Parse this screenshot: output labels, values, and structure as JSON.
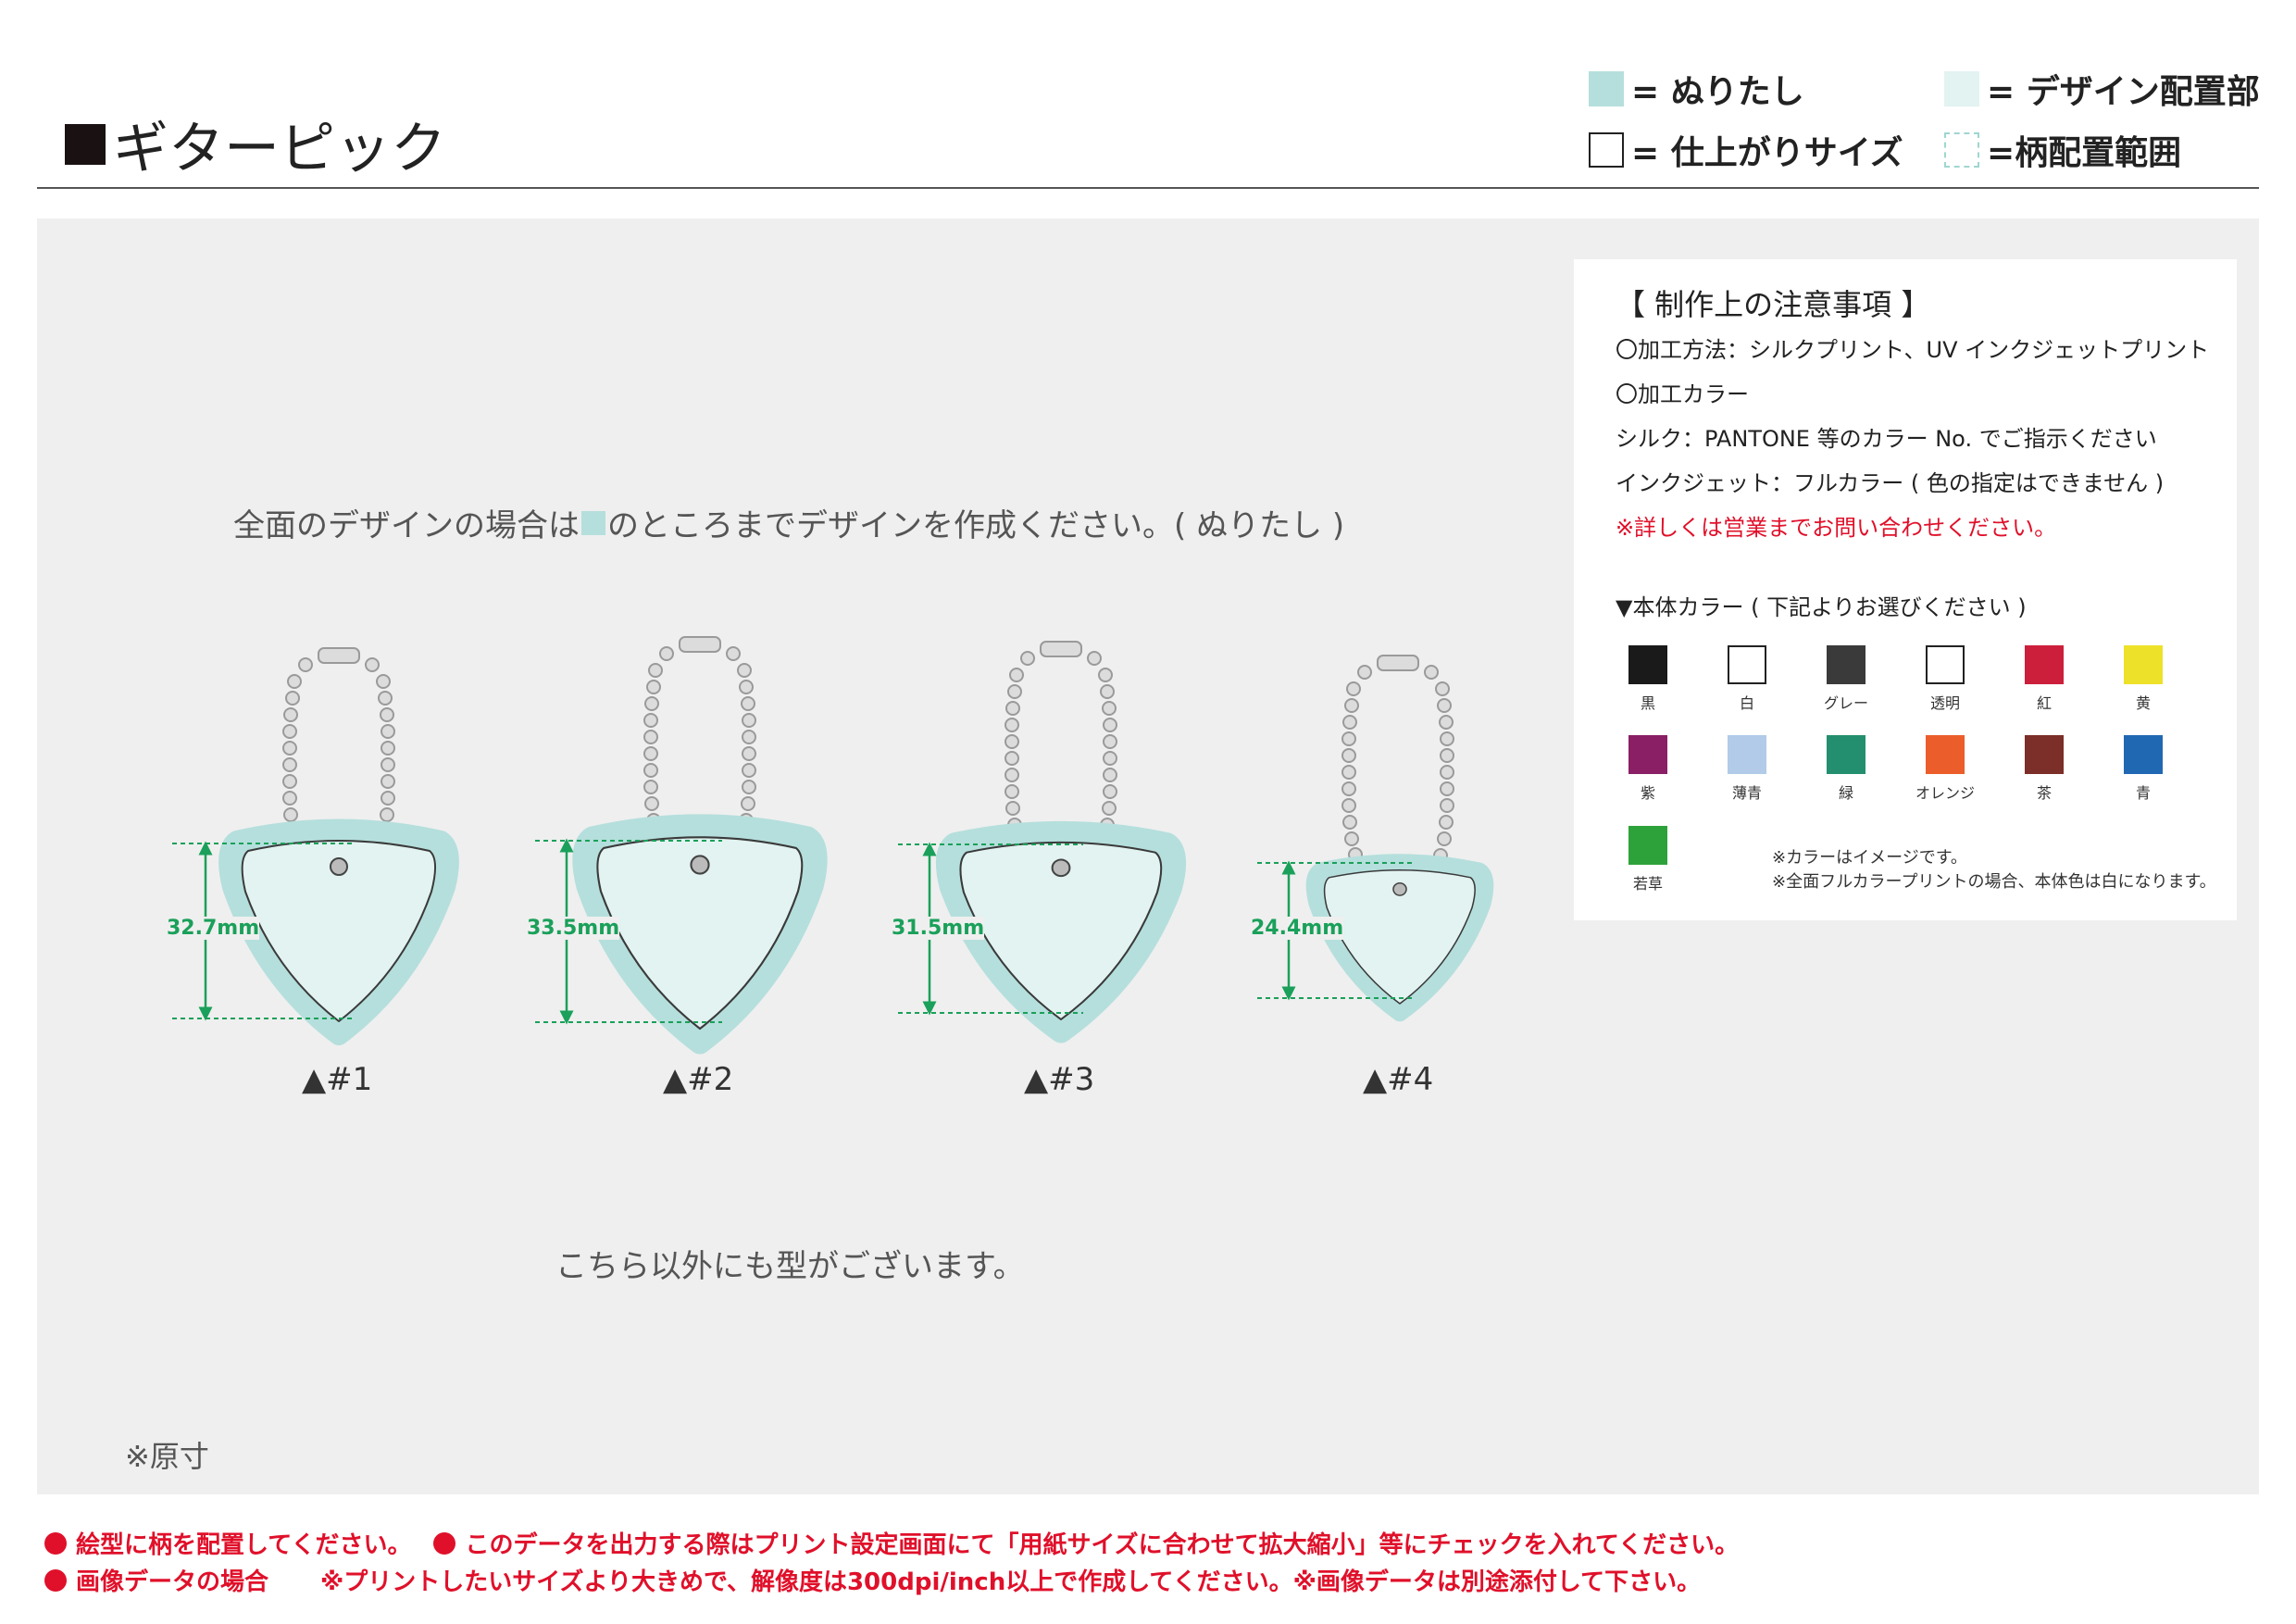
{
  "header": {
    "title": "ギターピック",
    "legend": {
      "fill": "= ぬりたし",
      "design_area": "= デザイン配置部",
      "finish_size": "= 仕上がりサイズ",
      "pattern_range": "=柄配置範囲"
    }
  },
  "main": {
    "fill_note_before": "全面のデザインの場合は",
    "fill_note_after": "のところまでデザインを作成ください。( ぬりたし )",
    "shapes": [
      {
        "label": "▲#1",
        "dimension": "32.7mm"
      },
      {
        "label": "▲#2",
        "dimension": "33.5mm"
      },
      {
        "label": "▲#3",
        "dimension": "31.5mm"
      },
      {
        "label": "▲#4",
        "dimension": "24.4mm"
      }
    ],
    "other_shapes_note": "こちら以外にも型がございます。",
    "actual_size_note": "※原寸"
  },
  "notice": {
    "title": "【 制作上の注意事項 】",
    "method": "〇加工方法：シルクプリント、UV インクジェットプリント",
    "color_heading": "〇加工カラー",
    "silk": "シルク：PANTONE 等のカラー No. でご指示ください",
    "inkjet": "インクジェット：フルカラー ( 色の指定はできません )",
    "contact": "※詳しくは営業までお問い合わせください。",
    "body_color_heading": "▼本体カラー ( 下記よりお選びください )",
    "colors": [
      {
        "name": "黒",
        "hex": "#1a1a1a"
      },
      {
        "name": "白",
        "hex": "#ffffff"
      },
      {
        "name": "グレー",
        "hex": "#3a3a3a"
      },
      {
        "name": "透明",
        "hex": "#ffffff"
      },
      {
        "name": "紅",
        "hex": "#cc1f3b"
      },
      {
        "name": "黄",
        "hex": "#ede12a"
      },
      {
        "name": "紫",
        "hex": "#8a1f66"
      },
      {
        "name": "薄青",
        "hex": "#b1cbe8"
      },
      {
        "name": "緑",
        "hex": "#248f6e"
      },
      {
        "name": "オレンジ",
        "hex": "#eb5e2b"
      },
      {
        "name": "茶",
        "hex": "#7c2e28"
      },
      {
        "name": "青",
        "hex": "#2168b3"
      },
      {
        "name": "若草",
        "hex": "#2ea23a"
      }
    ],
    "color_image_note": "※カラーはイメージです。",
    "fullcolor_note": "※全面フルカラープリントの場合、本体色は白になります。"
  },
  "footer": {
    "line1_a": "絵型に柄を配置してください。",
    "line1_b": "このデータを出力する際はプリント設定画面にて「用紙サイズに合わせて拡大縮小」等にチェックを入れてください。",
    "line2_a": "画像データの場合",
    "line2_b": "※プリントしたいサイズより大きめで、解像度は300dpi/inch以上で作成してください。※画像データは別途添付して下さい。"
  },
  "colors": {
    "fill": "#b5dfdc",
    "design": "#e2f3f1",
    "dimension": "#1aa05a",
    "accent_red": "#e0102a"
  }
}
